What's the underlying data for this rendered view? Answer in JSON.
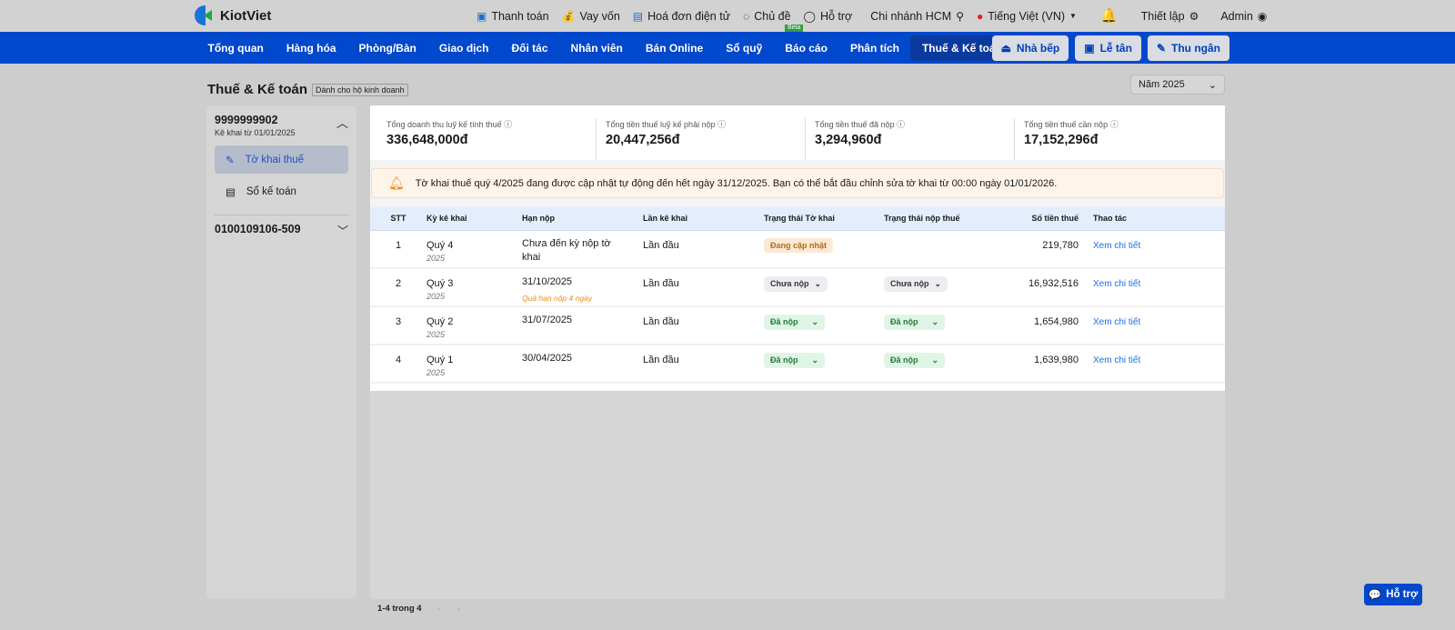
{
  "brand": "KiotViet",
  "topbar": {
    "links": [
      {
        "icon": "payment-icon",
        "label": "Thanh toán"
      },
      {
        "icon": "money-bag-icon",
        "label": "Vay vốn"
      },
      {
        "icon": "invoice-icon",
        "label": "Hoá đơn điện tử"
      },
      {
        "icon": "palette-icon",
        "label": "Chủ đề"
      },
      {
        "icon": "chat-icon",
        "label": "Hỗ trợ"
      }
    ],
    "beta": "Beta",
    "branch": "Chi nhánh HCM",
    "language": "Tiếng Việt (VN)",
    "settings": "Thiết lập",
    "user": "Admin"
  },
  "nav": {
    "items": [
      "Tổng quan",
      "Hàng hóa",
      "Phòng/Bàn",
      "Giao dịch",
      "Đối tác",
      "Nhân viên",
      "Bán Online",
      "Sổ quỹ",
      "Báo cáo",
      "Phân tích",
      "Thuế & Kế toán"
    ],
    "active": 10,
    "buttons": [
      "Nhà bếp",
      "Lễ tân",
      "Thu ngân"
    ]
  },
  "page": {
    "title": "Thuế & Kế toán",
    "tag": "Dành cho hộ kinh doanh",
    "year": "Năm 2025"
  },
  "sidebar": {
    "account1": {
      "id": "9999999902",
      "sub": "Kê khai từ 01/01/2025",
      "items": [
        "Tờ khai thuế",
        "Sổ kế toán"
      ]
    },
    "account2": {
      "id": "0100109106-509"
    }
  },
  "stats": [
    {
      "label": "Tổng doanh thu luỹ kế tính thuế",
      "value": "336,648,000đ"
    },
    {
      "label": "Tổng tiền thuế luỹ kế phải nộp",
      "value": "20,447,256đ"
    },
    {
      "label": "Tổng tiền thuế đã nộp",
      "value": "3,294,960đ"
    },
    {
      "label": "Tổng tiền thuế cần nộp",
      "value": "17,152,296đ"
    }
  ],
  "alert": "Tờ khai thuế quý 4/2025 đang được cập nhật tự động đến hết ngày 31/12/2025. Bạn có thể bắt đầu chỉnh sửa tờ khai từ 00:00 ngày 01/01/2026.",
  "table": {
    "headers": [
      "STT",
      "Kỳ kê khai",
      "Hạn nộp",
      "Lần kê khai",
      "Trạng thái Tờ khai",
      "Trạng thái nộp thuế",
      "Số tiền thuế",
      "Thao tác"
    ],
    "rows": [
      {
        "stt": "1",
        "period": "Quý 4",
        "year": "2025",
        "due": "Chưa đến kỳ nộp tờ khai",
        "note": "",
        "times": "Lần đầu",
        "form": "Đang cập nhật",
        "pay": "",
        "amount": "219,780",
        "action": "Xem chi tiết"
      },
      {
        "stt": "2",
        "period": "Quý 3",
        "year": "2025",
        "due": "31/10/2025",
        "note": "Quá hạn nộp 4 ngày",
        "times": "Lần đầu",
        "form": "Chưa nộp",
        "pay": "Chưa nộp",
        "amount": "16,932,516",
        "action": "Xem chi tiết"
      },
      {
        "stt": "3",
        "period": "Quý 2",
        "year": "2025",
        "due": "31/07/2025",
        "note": "",
        "times": "Lần đầu",
        "form": "Đã nộp",
        "pay": "Đã nộp",
        "amount": "1,654,980",
        "action": "Xem chi tiết"
      },
      {
        "stt": "4",
        "period": "Quý 1",
        "year": "2025",
        "due": "30/04/2025",
        "note": "",
        "times": "Lần đầu",
        "form": "Đã nộp",
        "pay": "Đã nộp",
        "amount": "1,639,980",
        "action": "Xem chi tiết"
      }
    ]
  },
  "pagination": "1-4 trong 4",
  "help": "Hỗ trợ"
}
